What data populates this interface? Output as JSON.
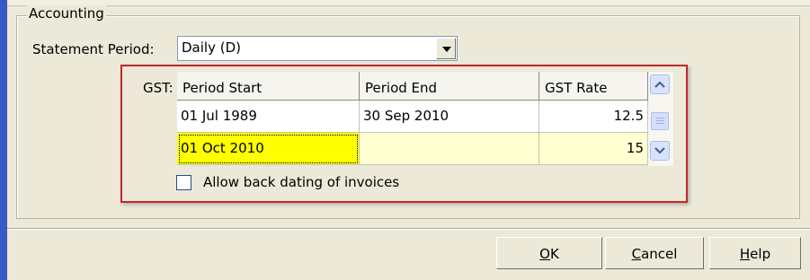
{
  "group": {
    "title": "Accounting"
  },
  "statement": {
    "label": "Statement Period:",
    "selected": "Daily (D)"
  },
  "gst": {
    "label": "GST:",
    "columns": [
      "Period Start",
      "Period End",
      "GST Rate"
    ],
    "rows": [
      {
        "start": "01 Jul 1989",
        "end": "30 Sep 2010",
        "rate": "12.5"
      },
      {
        "start": "01 Oct 2010",
        "end": "",
        "rate": "15"
      }
    ]
  },
  "allow_backdating": {
    "label": "Allow back dating of invoices",
    "checked": false
  },
  "buttons": {
    "ok": {
      "access_key": "O",
      "rest": "K"
    },
    "cancel": {
      "access_key": "C",
      "rest": "ancel"
    },
    "help": {
      "access_key": "H",
      "rest": "elp"
    }
  },
  "colors": {
    "highlight_border": "#c1272d",
    "current_cell": "#ffff00",
    "new_row": "#ffffd1",
    "side_rail": "#3a59c8"
  },
  "icons": [
    "dropdown-arrow-icon",
    "scroll-up-icon",
    "scroll-down-icon"
  ]
}
